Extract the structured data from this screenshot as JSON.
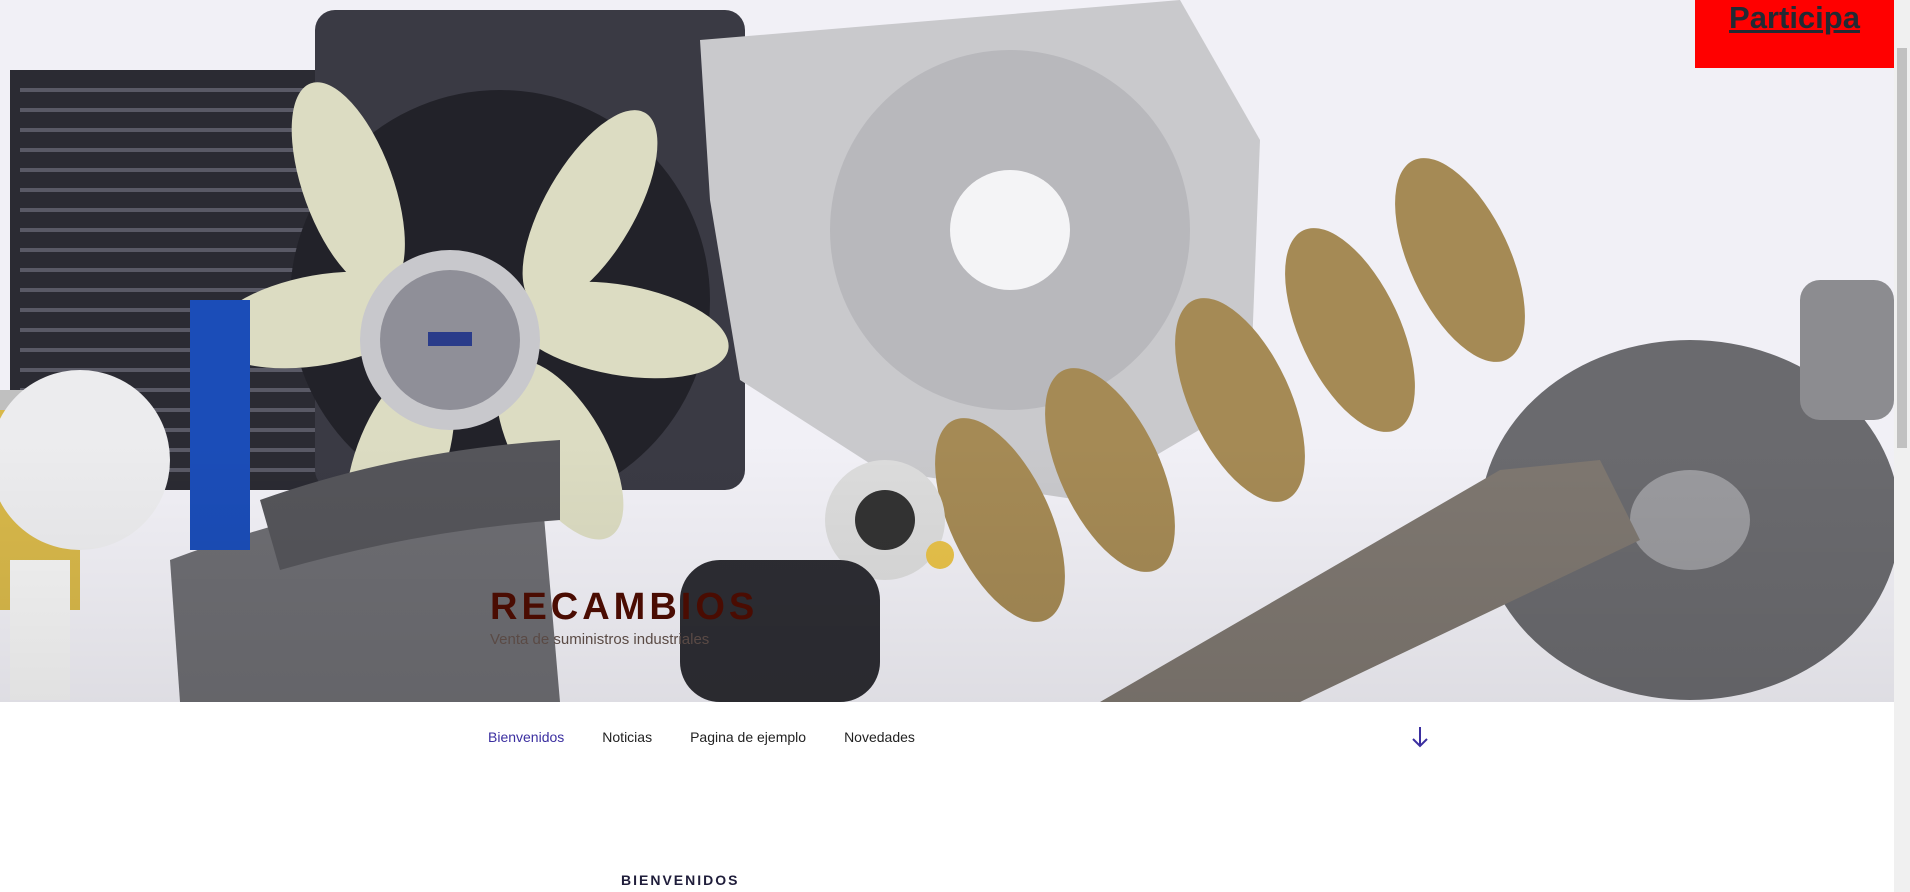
{
  "header": {
    "site_title": "RECAMBIOS",
    "site_description": "Venta de suministros industriales"
  },
  "cta": {
    "label": "Participa"
  },
  "nav": {
    "items": [
      {
        "label": "Bienvenidos",
        "active": true
      },
      {
        "label": "Noticias",
        "active": false
      },
      {
        "label": "Pagina de ejemplo",
        "active": false
      },
      {
        "label": "Novedades",
        "active": false
      }
    ],
    "scroll_icon": "arrow-down-icon"
  },
  "content": {
    "section_title": "BIENVENIDOS"
  },
  "colors": {
    "cta_bg": "#ff0000",
    "title": "#4a0c02",
    "nav_active": "#3b2fa0"
  }
}
